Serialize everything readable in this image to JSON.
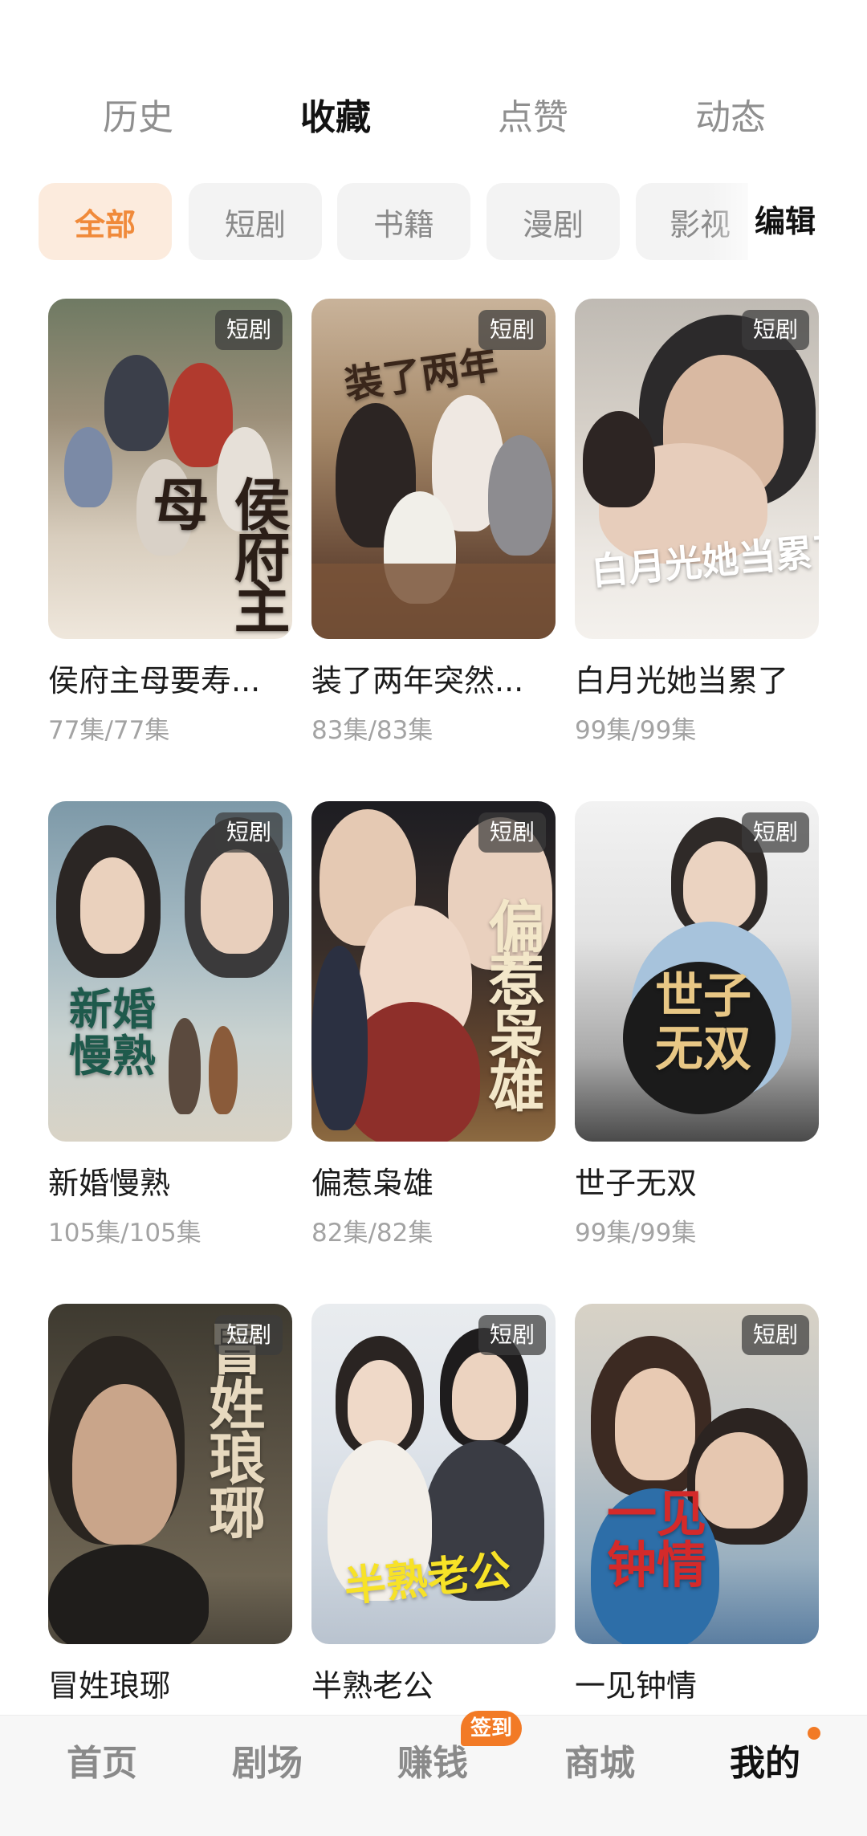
{
  "top_tabs": [
    {
      "label": "历史",
      "active": false
    },
    {
      "label": "收藏",
      "active": true
    },
    {
      "label": "点赞",
      "active": false
    },
    {
      "label": "动态",
      "active": false
    }
  ],
  "filters": [
    {
      "label": "全部",
      "active": true
    },
    {
      "label": "短剧",
      "active": false
    },
    {
      "label": "书籍",
      "active": false
    },
    {
      "label": "漫剧",
      "active": false
    },
    {
      "label": "影视",
      "active": false
    }
  ],
  "edit_label": "编辑",
  "items": [
    {
      "title": "侯府主母要寿...",
      "episodes": "77集/77集",
      "tag": "短剧",
      "art": "侯府主母"
    },
    {
      "title": "装了两年突然...",
      "episodes": "83集/83集",
      "tag": "短剧",
      "art": "装了两年"
    },
    {
      "title": "白月光她当累了",
      "episodes": "99集/99集",
      "tag": "短剧",
      "art": "白月光她当累了"
    },
    {
      "title": "新婚慢熟",
      "episodes": "105集/105集",
      "tag": "短剧",
      "art": "新婚慢熟"
    },
    {
      "title": "偏惹枭雄",
      "episodes": "82集/82集",
      "tag": "短剧",
      "art": "偏惹枭雄"
    },
    {
      "title": "世子无双",
      "episodes": "99集/99集",
      "tag": "短剧",
      "art": "世子无双"
    },
    {
      "title": "冒姓琅琊",
      "episodes": "",
      "tag": "短剧",
      "art": "冒姓琅琊"
    },
    {
      "title": "半熟老公",
      "episodes": "",
      "tag": "短剧",
      "art": "半熟老公"
    },
    {
      "title": "一见钟情",
      "episodes": "",
      "tag": "短剧",
      "art": "一见钟情"
    }
  ],
  "bottom_nav": [
    {
      "label": "首页",
      "active": false
    },
    {
      "label": "剧场",
      "active": false
    },
    {
      "label": "赚钱",
      "active": false,
      "badge": "签到"
    },
    {
      "label": "商城",
      "active": false
    },
    {
      "label": "我的",
      "active": true
    }
  ],
  "colors": {
    "accent": "#f08a3a",
    "badge": "#f27a26"
  }
}
